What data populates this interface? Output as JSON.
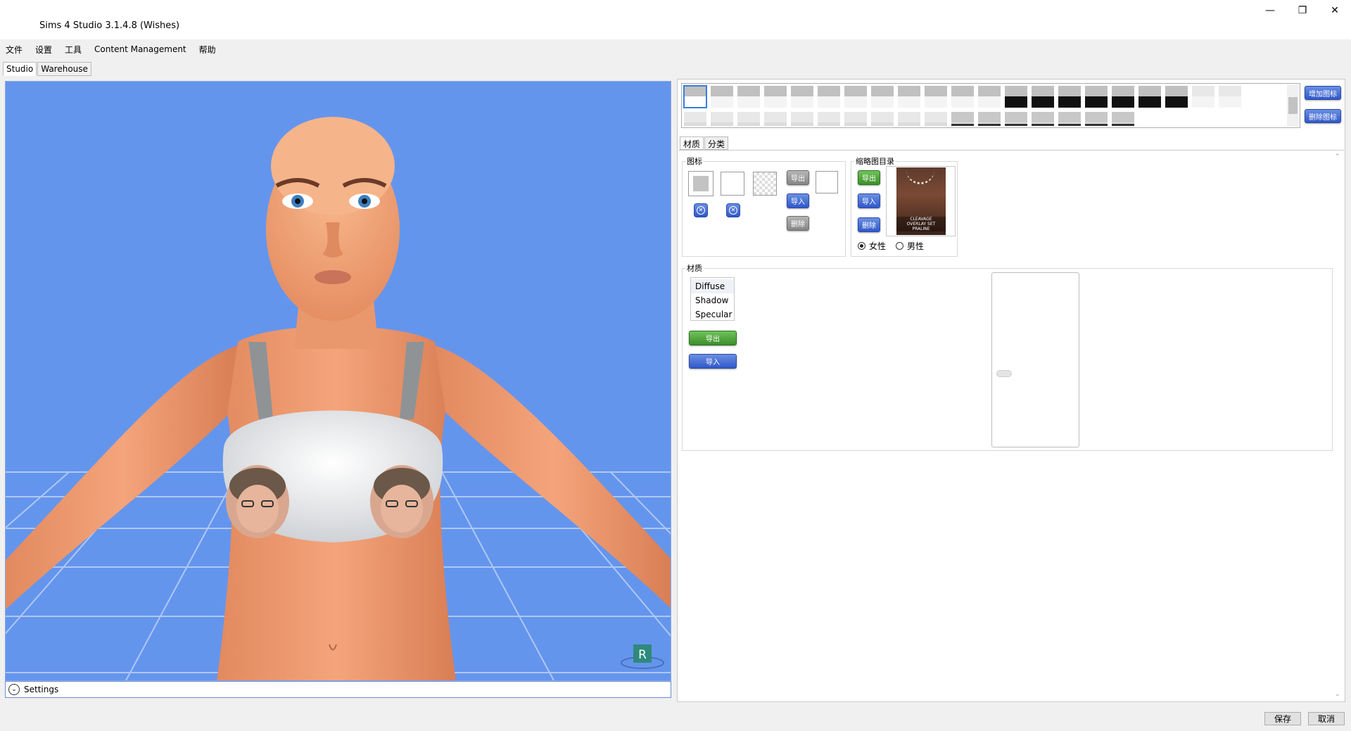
{
  "window": {
    "title": "Sims 4 Studio 3.1.4.8 (Wishes)",
    "controls": [
      "—",
      "❐",
      "✕"
    ]
  },
  "menu": [
    "文件",
    "设置",
    "工具",
    "Content Management",
    "帮助"
  ],
  "main_tabs": [
    {
      "label": "Studio",
      "active": true
    },
    {
      "label": "Warehouse",
      "active": false
    }
  ],
  "viewport": {
    "background": "#6495ed",
    "settings_label": "Settings",
    "logo_letter": "R"
  },
  "swatches": {
    "add_label": "增加图标",
    "remove_label": "删除图标"
  },
  "sub_tabs": [
    {
      "label": "材质",
      "active": true
    },
    {
      "label": "分类",
      "active": false
    }
  ],
  "icon_group": {
    "label": "图标",
    "export_label": "导出",
    "import_label": "导入",
    "delete_label": "删除"
  },
  "thumb_group": {
    "label": "缩略图目录",
    "export_label": "导出",
    "import_label": "导入",
    "delete_label": "删除",
    "thumb_caption_1": "CLEAVAGE",
    "thumb_caption_2": "OVERLAY SET",
    "thumb_caption_3": "PRALINE",
    "gender_female": "女性",
    "gender_male": "男性",
    "selected_gender": "女性"
  },
  "material_group": {
    "label": "材质",
    "items": [
      "Diffuse",
      "Shadow",
      "Specular"
    ],
    "export_label": "导出",
    "import_label": "导入"
  },
  "footer": {
    "save_label": "保存",
    "cancel_label": "取消"
  },
  "colors": {
    "accent_blue": "#3058c9",
    "accent_green": "#3b8f2a",
    "viewport_sky": "#6495ed"
  }
}
